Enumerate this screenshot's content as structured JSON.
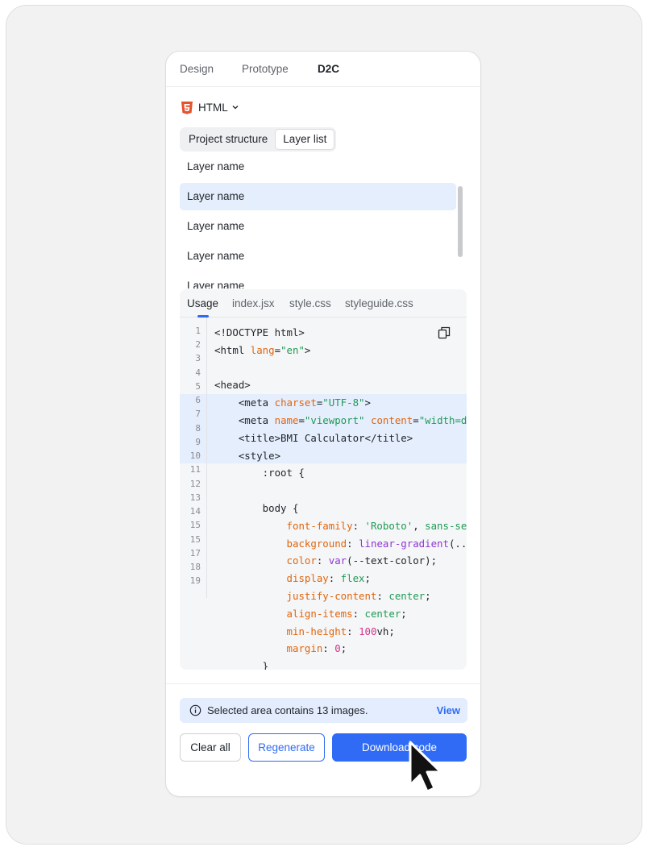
{
  "top_tabs": [
    "Design",
    "Prototype",
    "D2C"
  ],
  "active_top_tab": "D2C",
  "language": {
    "label": "HTML",
    "icon": "html5-icon"
  },
  "view_toggle": {
    "items": [
      "Project structure",
      "Layer list"
    ],
    "active": "Layer list"
  },
  "layers": [
    "Layer name",
    "Layer name",
    "Layer name",
    "Layer name",
    "Layer name"
  ],
  "selected_layer_index": 1,
  "code_tabs": [
    "Usage",
    "index.jsx",
    "style.css",
    "styleguide.css"
  ],
  "active_code_tab": "Usage",
  "line_numbers": [
    "1",
    "2",
    "3",
    "4",
    "5",
    "6",
    "7",
    "8",
    "9",
    "10",
    "11",
    "12",
    "13",
    "14",
    "15",
    "15",
    "17",
    "18",
    "19"
  ],
  "notice": {
    "text": "Selected area contains 13 images.",
    "link": "View"
  },
  "buttons": {
    "clear": "Clear all",
    "regenerate": "Regenerate",
    "download": "Download code"
  },
  "colors": {
    "accent": "#2f6bf5",
    "highlight": "#e5eefc",
    "attribute": "#e0650f",
    "string": "#1f9a55",
    "function": "#8d36d6",
    "number": "#d6348c"
  }
}
